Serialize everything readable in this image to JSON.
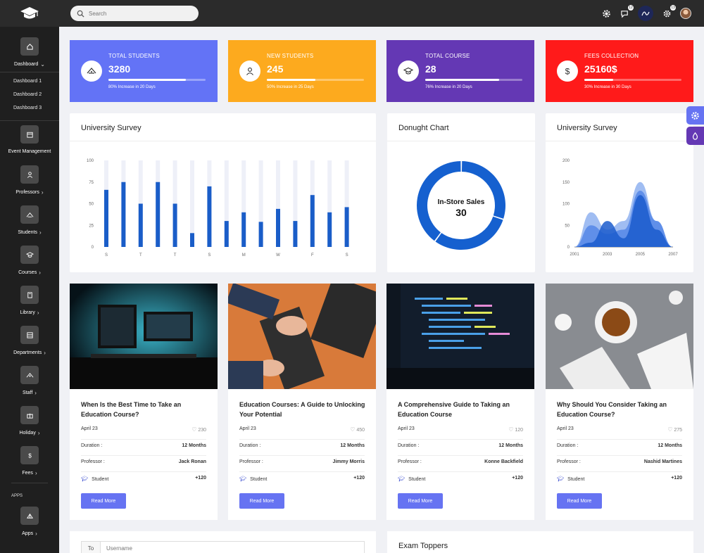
{
  "header": {
    "search_placeholder": "Search",
    "chat_badge": "12",
    "settings_badge": "13"
  },
  "sidebar": {
    "dashboard_label": "Dashboard",
    "sub_items": [
      "Dashboard 1",
      "Dashboard 2",
      "Dashboard 3"
    ],
    "items": [
      {
        "label": "Event Management",
        "icon": "calendar-icon"
      },
      {
        "label": "Professors",
        "icon": "user-icon"
      },
      {
        "label": "Students",
        "icon": "students-icon"
      },
      {
        "label": "Courses",
        "icon": "graduation-cap-icon"
      },
      {
        "label": "Library",
        "icon": "book-icon"
      },
      {
        "label": "Departments",
        "icon": "building-icon"
      },
      {
        "label": "Staff",
        "icon": "staff-icon"
      },
      {
        "label": "Holiday",
        "icon": "gift-icon"
      },
      {
        "label": "Fees",
        "icon": "dollar-icon"
      }
    ],
    "apps_heading": "APPS",
    "apps_label": "Apps"
  },
  "stats": [
    {
      "title": "TOTAL STUDENTS",
      "value": "3280",
      "note": "80% Increase in 20 Days",
      "progress": 0.8,
      "color": "#6373f6",
      "icon": "students-icon"
    },
    {
      "title": "NEW STUDENTS",
      "value": "245",
      "note": "50% Increase in 25 Days",
      "progress": 0.5,
      "color": "#fdaa1e",
      "icon": "user-icon"
    },
    {
      "title": "TOTAL COURSE",
      "value": "28",
      "note": "76% Increase in 20 Days",
      "progress": 0.76,
      "color": "#6438b4",
      "icon": "graduation-cap-icon"
    },
    {
      "title": "FEES COLLECTION",
      "value": "25160$",
      "note": "30% Increase in 30 Days",
      "progress": 0.3,
      "color": "#ff1a1a",
      "icon": "dollar-icon"
    }
  ],
  "chart_data": [
    {
      "type": "bar",
      "title": "University Survey",
      "categories": [
        "S",
        "",
        "T",
        "",
        "T",
        "",
        "S",
        "",
        "M",
        "",
        "W",
        "",
        "F",
        "",
        "S"
      ],
      "values": [
        66,
        75,
        50,
        75,
        50,
        16,
        70,
        30,
        40,
        29,
        44,
        30,
        60,
        40,
        46
      ],
      "max_values": [
        100,
        100,
        100,
        100,
        100,
        100,
        100,
        100,
        100,
        100,
        100,
        100,
        100,
        100,
        100
      ],
      "yticks": [
        0,
        25,
        50,
        75,
        100
      ],
      "ylim": [
        0,
        100
      ],
      "color": "#1a5dc8",
      "track_color": "#eef0f8"
    },
    {
      "type": "pie",
      "title": "Donught Chart",
      "center_label": "In-Store Sales",
      "center_value": "30",
      "slices": [
        {
          "value": 30,
          "color": "#1560cf"
        },
        {
          "value": 30,
          "color": "#1560cf"
        },
        {
          "value": 40,
          "color": "#1560cf"
        }
      ]
    },
    {
      "type": "area",
      "title": "University Survey",
      "x": [
        2001,
        2002,
        2003,
        2004,
        2005,
        2006,
        2007
      ],
      "xticks": [
        2001,
        2003,
        2005,
        2007
      ],
      "yticks": [
        0,
        50,
        100,
        150,
        200
      ],
      "ylim": [
        0,
        200
      ],
      "series": [
        {
          "values": [
            0,
            80,
            40,
            60,
            150,
            60,
            0
          ],
          "color": "#8fb2f0"
        },
        {
          "values": [
            0,
            50,
            30,
            40,
            130,
            60,
            0
          ],
          "color": "#5587e8"
        },
        {
          "values": [
            0,
            10,
            60,
            20,
            120,
            40,
            0
          ],
          "color": "#1b5ccc"
        }
      ]
    }
  ],
  "blogs": [
    {
      "title": "When Is the Best Time to Take an Education Course?",
      "date": "April 23",
      "likes": "230",
      "duration_label": "Duration :",
      "duration": "12 Months",
      "professor_label": "Professor :",
      "professor": "Jack Ronan",
      "student_label": "Student",
      "students": "+120",
      "button": "Read More",
      "image": "monitor-desk"
    },
    {
      "title": "Education Courses: A Guide to Unlocking Your Potential",
      "date": "April 23",
      "likes": "450",
      "duration_label": "Duration :",
      "duration": "12 Months",
      "professor_label": "Professor :",
      "professor": "Jimmy Morris",
      "student_label": "Student",
      "students": "+120",
      "button": "Read More",
      "image": "keyboard-typing"
    },
    {
      "title": "A Comprehensive Guide to Taking an Education Course",
      "date": "April 23",
      "likes": "120",
      "duration_label": "Duration :",
      "duration": "12 Months",
      "professor_label": "Professor :",
      "professor": "Konne Backfield",
      "student_label": "Student",
      "students": "+120",
      "button": "Read More",
      "image": "code-screen"
    },
    {
      "title": "Why Should You Consider Taking an Education Course?",
      "date": "April 23",
      "likes": "275",
      "duration_label": "Duration :",
      "duration": "12 Months",
      "professor_label": "Professor :",
      "professor": "Nashid Martines",
      "student_label": "Student",
      "students": "+120",
      "button": "Read More",
      "image": "tea-book"
    }
  ],
  "email": {
    "to_label": "To",
    "username_placeholder": "Username"
  },
  "exam_toppers": {
    "title": "Exam Toppers"
  }
}
